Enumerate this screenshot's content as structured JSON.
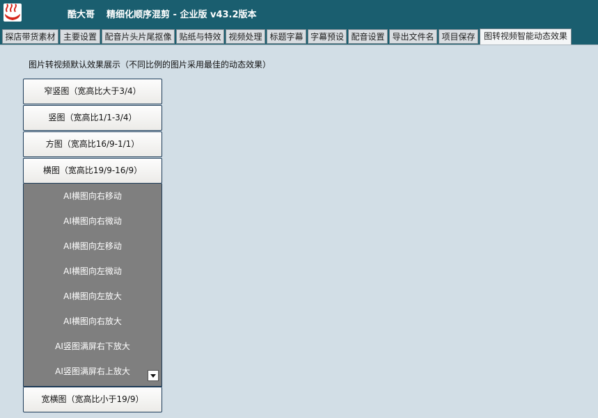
{
  "header": {
    "brand": "酷大哥",
    "title": "精细化顺序混剪 - 企业版 v43.2版本"
  },
  "tabs": [
    {
      "label": "探店带货素材"
    },
    {
      "label": "主要设置"
    },
    {
      "label": "配音片头片尾抠像"
    },
    {
      "label": "贴纸与特效"
    },
    {
      "label": "视频处理"
    },
    {
      "label": "标题字幕"
    },
    {
      "label": "字幕预设"
    },
    {
      "label": "配音设置"
    },
    {
      "label": "导出文件名"
    },
    {
      "label": "项目保存"
    },
    {
      "label": "图转视频智能动态效果"
    }
  ],
  "main": {
    "description": "图片转视频默认效果展示（不同比例的图片采用最佳的动态效果）",
    "categories": [
      {
        "label": "窄竖图（宽高比大于3/4）"
      },
      {
        "label": "竖图（宽高比1/1-3/4）"
      },
      {
        "label": "方图（宽高比16/9-1/1）"
      },
      {
        "label": "横图（宽高比19/9-16/9）"
      },
      {
        "label": "宽横图（宽高比小于19/9）"
      }
    ],
    "effects": [
      {
        "label": "AI横图向右移动"
      },
      {
        "label": "AI横图向右微动"
      },
      {
        "label": "AI横图向左移动"
      },
      {
        "label": "AI横图向左微动"
      },
      {
        "label": "AI横图向左放大"
      },
      {
        "label": "AI横图向右放大"
      },
      {
        "label": "AI竖图满屏右下放大"
      },
      {
        "label": "AI竖图满屏右上放大"
      }
    ]
  },
  "icons": {
    "logo": "hot-spring-logo-icon",
    "scroll": "chevron-down-icon"
  },
  "colors": {
    "titlebar": "#1a5e6f",
    "panel_bg": "#d2dee6",
    "list_bg": "#7f7f7f",
    "button_border": "#1b3a57",
    "logo_red": "#d6271c"
  }
}
